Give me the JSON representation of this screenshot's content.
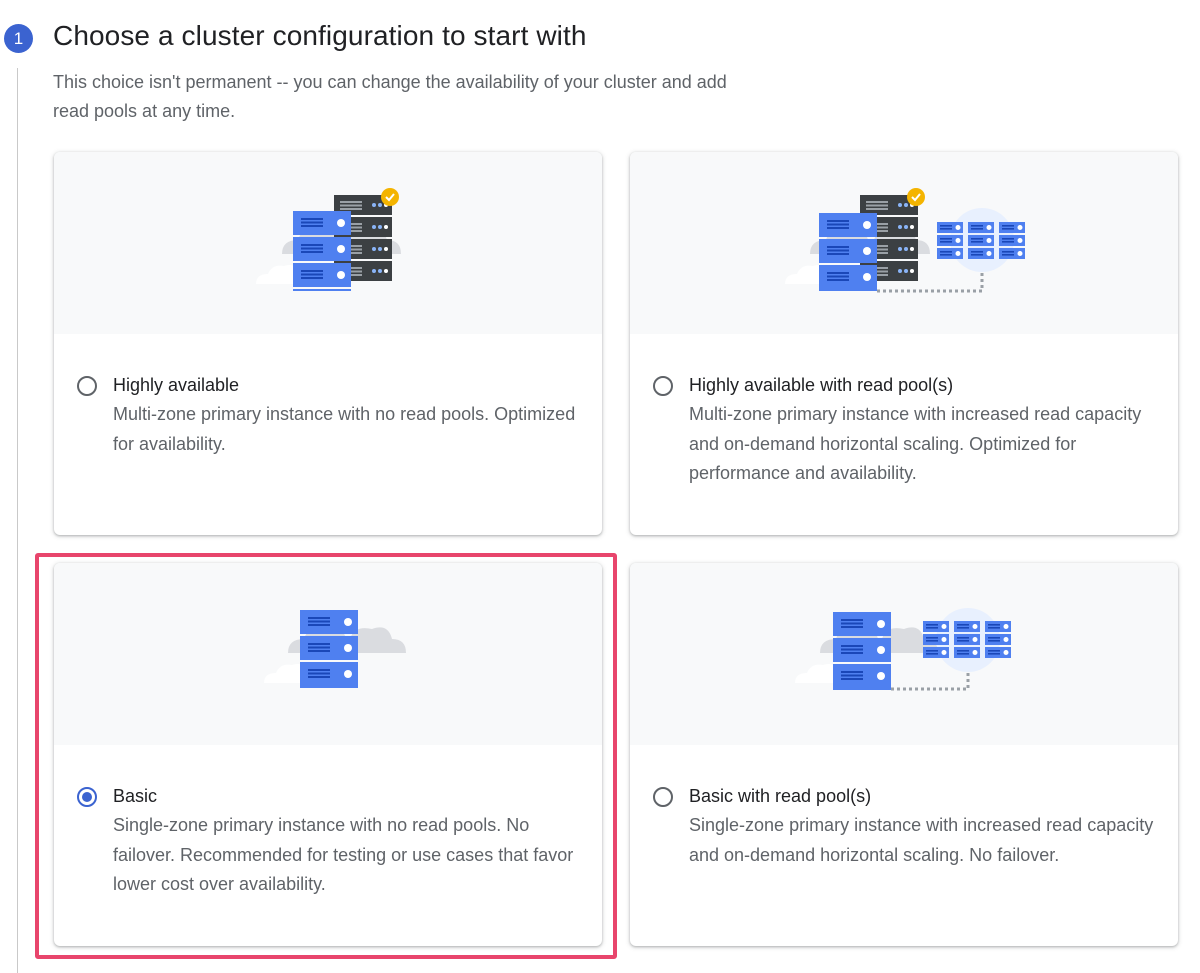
{
  "step": {
    "number": "1"
  },
  "header": {
    "title": "Choose a cluster configuration to start with",
    "subtitle": "This choice isn't permanent -- you can change the availability of your cluster and add read pools at any time."
  },
  "options": [
    {
      "id": "highly-available",
      "label": "Highly available",
      "description": "Multi-zone primary instance with no read pools. Optimized for availability.",
      "selected": false
    },
    {
      "id": "highly-available-read-pools",
      "label": "Highly available with read pool(s)",
      "description": "Multi-zone primary instance with increased read capacity and on-demand horizontal scaling. Optimized for performance and availability.",
      "selected": false
    },
    {
      "id": "basic",
      "label": "Basic",
      "description": "Single-zone primary instance with no read pools. No failover. Recommended for testing or use cases that favor lower cost over availability.",
      "selected": true
    },
    {
      "id": "basic-read-pools",
      "label": "Basic with read pool(s)",
      "description": "Single-zone primary instance with increased read capacity and on-demand horizontal scaling. No failover.",
      "selected": false
    }
  ],
  "colors": {
    "accent": "#3b63d0",
    "server_blue": "#4f80f0",
    "server_dark": "#3c4043",
    "check_badge": "#f4b400",
    "highlight": "#e8456c"
  }
}
